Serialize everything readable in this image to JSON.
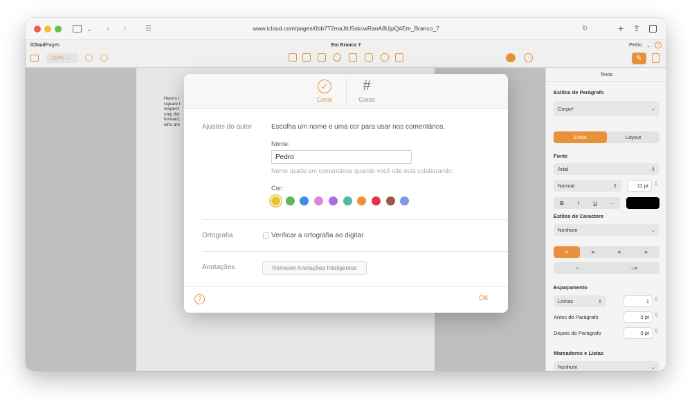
{
  "browser": {
    "url": "www.icloud.com/pages/0bb7T2maJtU5skcwRaoA8UjpQ#Em_Branco_7"
  },
  "app": {
    "brand": "iCloud",
    "brand_app": "Pages",
    "doc_title": "Em Branco 7",
    "user_menu": "Pedro",
    "zoom": "111%"
  },
  "document": {
    "lines": [
      "Here's t",
      "square t",
      "respect",
      "only thir",
      "forward,",
      "who are"
    ]
  },
  "inspector": {
    "title": "Texto",
    "paragraph_styles_heading": "Estilos de Parágrafo",
    "paragraph_style": "Corpo*",
    "tabs": [
      "Estilo",
      "Layout"
    ],
    "font_heading": "Fonte",
    "font_name": "Arial",
    "font_weight": "Normal",
    "font_size": "11 pt",
    "format_buttons": [
      "B",
      "I",
      "U",
      "···"
    ],
    "char_styles_heading": "Estilos de Caractere",
    "char_style": "Nenhum",
    "spacing_heading": "Espaçamento",
    "line_spacing_mode": "Linhas",
    "line_spacing_value": "1",
    "before_label": "Antes do Parágrafo",
    "before_value": "0 pt",
    "after_label": "Depois do Parágrafo",
    "after_value": "0 pt",
    "bullets_heading": "Marcadores e Listas",
    "bullets_value": "Nenhum"
  },
  "dialog": {
    "tabs": [
      {
        "label": "Geral",
        "icon": "checkmark-circle-icon"
      },
      {
        "label": "Guias",
        "icon": "grid-icon"
      }
    ],
    "author_section_label": "Ajustes do autor",
    "author_description": "Escolha um nome e uma cor para usar nos comentários.",
    "name_label": "Nome:",
    "name_value": "Pedro",
    "name_hint": "Nome usado em comentários quando você não está colaborando.",
    "color_label": "Cor:",
    "colors": [
      "#e8c23a",
      "#5cb85c",
      "#3d8ee8",
      "#e084d8",
      "#a56fe0",
      "#52b8a0",
      "#f0913a",
      "#e0344a",
      "#9a5a44",
      "#7f98e0"
    ],
    "selected_color_index": 0,
    "spelling_section_label": "Ortografia",
    "spelling_checkbox_label": "Verificar a ortografia ao digitar",
    "annotations_section_label": "Anotações",
    "remove_annotations_button": "Remover Anotações Inteligentes",
    "ok_button": "OK",
    "help_icon": "question-mark-circle-icon"
  },
  "accent_color": "#e8913a"
}
